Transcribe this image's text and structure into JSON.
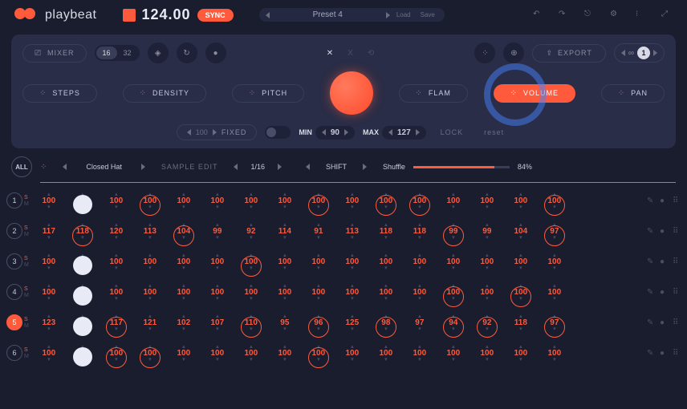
{
  "brand": "playbeat",
  "tempo": "124.00",
  "sync": "SYNC",
  "preset": {
    "name": "Preset 4",
    "load": "Load",
    "save": "Save"
  },
  "panel": {
    "mixer": "MIXER",
    "steps16": "16",
    "steps32": "32",
    "export": "EXPORT",
    "loop_count": "1",
    "params": {
      "steps": "STEPS",
      "density": "DENSITY",
      "pitch": "PITCH",
      "flam": "FLAM",
      "volume": "VOLUME",
      "pan": "PAN"
    },
    "fixed_val": "100",
    "fixed": "FIXED",
    "min_label": "MIN",
    "min_val": "90",
    "max_label": "MAX",
    "max_val": "127",
    "lock": "LOCK",
    "reset": "reset"
  },
  "seq_header": {
    "all": "ALL",
    "sample_name": "Closed Hat",
    "sample_edit": "SAMPLE EDIT",
    "division": "1/16",
    "shift": "SHIFT",
    "shuffle": "Shuffle",
    "shuffle_pct": "84%"
  },
  "tracks": [
    {
      "n": "1",
      "active": false,
      "steps": [
        {
          "v": "100",
          "c": false,
          "w": false
        },
        {
          "v": "",
          "c": false,
          "w": true
        },
        {
          "v": "100",
          "c": false,
          "w": false
        },
        {
          "v": "100",
          "c": true,
          "w": false
        },
        {
          "v": "100",
          "c": false,
          "w": false
        },
        {
          "v": "100",
          "c": false,
          "w": false
        },
        {
          "v": "100",
          "c": false,
          "w": false
        },
        {
          "v": "100",
          "c": false,
          "w": false
        },
        {
          "v": "100",
          "c": true,
          "w": false
        },
        {
          "v": "100",
          "c": false,
          "w": false
        },
        {
          "v": "100",
          "c": true,
          "w": false
        },
        {
          "v": "100",
          "c": true,
          "w": false
        },
        {
          "v": "100",
          "c": false,
          "w": false
        },
        {
          "v": "100",
          "c": false,
          "w": false
        },
        {
          "v": "100",
          "c": false,
          "w": false
        },
        {
          "v": "100",
          "c": true,
          "w": false
        }
      ]
    },
    {
      "n": "2",
      "active": false,
      "steps": [
        {
          "v": "117",
          "c": false,
          "w": false
        },
        {
          "v": "118",
          "c": true,
          "w": false
        },
        {
          "v": "120",
          "c": false,
          "w": false
        },
        {
          "v": "113",
          "c": false,
          "w": false
        },
        {
          "v": "104",
          "c": true,
          "w": false
        },
        {
          "v": "99",
          "c": false,
          "w": false
        },
        {
          "v": "92",
          "c": false,
          "w": false
        },
        {
          "v": "114",
          "c": false,
          "w": false
        },
        {
          "v": "91",
          "c": false,
          "w": false
        },
        {
          "v": "113",
          "c": false,
          "w": false
        },
        {
          "v": "118",
          "c": false,
          "w": false
        },
        {
          "v": "118",
          "c": false,
          "w": false
        },
        {
          "v": "99",
          "c": true,
          "w": false
        },
        {
          "v": "99",
          "c": false,
          "w": false
        },
        {
          "v": "104",
          "c": false,
          "w": false
        },
        {
          "v": "97",
          "c": true,
          "w": false
        }
      ]
    },
    {
      "n": "3",
      "active": false,
      "steps": [
        {
          "v": "100",
          "c": false,
          "w": false
        },
        {
          "v": "",
          "c": false,
          "w": true
        },
        {
          "v": "100",
          "c": false,
          "w": false
        },
        {
          "v": "100",
          "c": false,
          "w": false
        },
        {
          "v": "100",
          "c": false,
          "w": false
        },
        {
          "v": "100",
          "c": false,
          "w": false
        },
        {
          "v": "100",
          "c": true,
          "w": false
        },
        {
          "v": "100",
          "c": false,
          "w": false
        },
        {
          "v": "100",
          "c": false,
          "w": false
        },
        {
          "v": "100",
          "c": false,
          "w": false
        },
        {
          "v": "100",
          "c": false,
          "w": false
        },
        {
          "v": "100",
          "c": false,
          "w": false
        },
        {
          "v": "100",
          "c": false,
          "w": false
        },
        {
          "v": "100",
          "c": false,
          "w": false
        },
        {
          "v": "100",
          "c": false,
          "w": false
        },
        {
          "v": "100",
          "c": false,
          "w": false
        }
      ]
    },
    {
      "n": "4",
      "active": false,
      "steps": [
        {
          "v": "100",
          "c": false,
          "w": false
        },
        {
          "v": "",
          "c": false,
          "w": true
        },
        {
          "v": "100",
          "c": false,
          "w": false
        },
        {
          "v": "100",
          "c": false,
          "w": false
        },
        {
          "v": "100",
          "c": false,
          "w": false
        },
        {
          "v": "100",
          "c": false,
          "w": false
        },
        {
          "v": "100",
          "c": false,
          "w": false
        },
        {
          "v": "100",
          "c": false,
          "w": false
        },
        {
          "v": "100",
          "c": false,
          "w": false
        },
        {
          "v": "100",
          "c": false,
          "w": false
        },
        {
          "v": "100",
          "c": false,
          "w": false
        },
        {
          "v": "100",
          "c": false,
          "w": false
        },
        {
          "v": "100",
          "c": true,
          "w": false
        },
        {
          "v": "100",
          "c": false,
          "w": false
        },
        {
          "v": "100",
          "c": true,
          "w": false
        },
        {
          "v": "100",
          "c": false,
          "w": false
        }
      ]
    },
    {
      "n": "5",
      "active": true,
      "steps": [
        {
          "v": "123",
          "c": false,
          "w": false
        },
        {
          "v": "",
          "c": false,
          "w": true
        },
        {
          "v": "117",
          "c": true,
          "w": false
        },
        {
          "v": "121",
          "c": false,
          "w": false
        },
        {
          "v": "102",
          "c": false,
          "w": false
        },
        {
          "v": "107",
          "c": false,
          "w": false
        },
        {
          "v": "110",
          "c": true,
          "w": false
        },
        {
          "v": "95",
          "c": false,
          "w": false
        },
        {
          "v": "96",
          "c": true,
          "w": false
        },
        {
          "v": "125",
          "c": false,
          "w": false
        },
        {
          "v": "98",
          "c": true,
          "w": false
        },
        {
          "v": "97",
          "c": false,
          "w": false
        },
        {
          "v": "94",
          "c": true,
          "w": false
        },
        {
          "v": "92",
          "c": true,
          "w": false
        },
        {
          "v": "118",
          "c": false,
          "w": false
        },
        {
          "v": "97",
          "c": true,
          "w": false
        }
      ]
    },
    {
      "n": "6",
      "active": false,
      "steps": [
        {
          "v": "100",
          "c": false,
          "w": false
        },
        {
          "v": "",
          "c": false,
          "w": true
        },
        {
          "v": "100",
          "c": true,
          "w": false
        },
        {
          "v": "100",
          "c": true,
          "w": false
        },
        {
          "v": "100",
          "c": false,
          "w": false
        },
        {
          "v": "100",
          "c": false,
          "w": false
        },
        {
          "v": "100",
          "c": false,
          "w": false
        },
        {
          "v": "100",
          "c": false,
          "w": false
        },
        {
          "v": "100",
          "c": true,
          "w": false
        },
        {
          "v": "100",
          "c": false,
          "w": false
        },
        {
          "v": "100",
          "c": false,
          "w": false
        },
        {
          "v": "100",
          "c": false,
          "w": false
        },
        {
          "v": "100",
          "c": false,
          "w": false
        },
        {
          "v": "100",
          "c": false,
          "w": false
        },
        {
          "v": "100",
          "c": false,
          "w": false
        },
        {
          "v": "100",
          "c": false,
          "w": false
        }
      ]
    }
  ]
}
